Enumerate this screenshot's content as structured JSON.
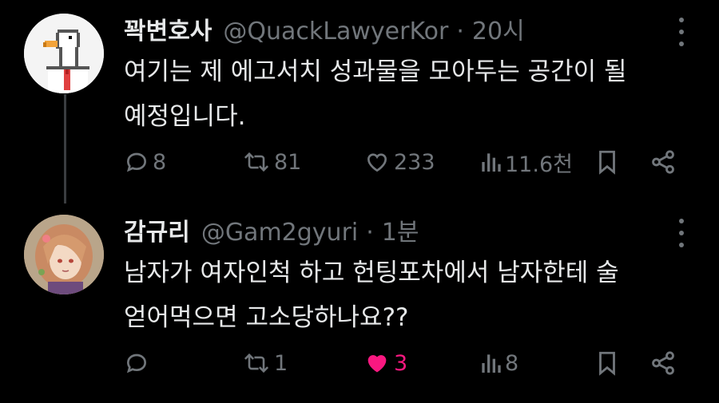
{
  "tweets": [
    {
      "display_name": "꽉변호사",
      "handle": "@QuackLawyerKor",
      "separator": "·",
      "time": "20시",
      "avatar_icon": "goose-avatar",
      "text": "여기는 제 에고서치 성과물을 모아두는 공간이 될\n예정입니다.",
      "actions": {
        "replies": "8",
        "retweets": "81",
        "likes": "233",
        "views": "11.6천",
        "liked": false
      }
    },
    {
      "display_name": "감규리",
      "handle": "@Gam2gyuri",
      "separator": "·",
      "time": "1분",
      "avatar_icon": "anime-girl-avatar",
      "text": "남자가 여자인척 하고 헌팅포차에서 남자한테 술\n얻어먹으면 고소당하나요??",
      "actions": {
        "replies": "",
        "retweets": "1",
        "likes": "3",
        "views": "8",
        "liked": true
      }
    }
  ],
  "colors": {
    "background": "#000000",
    "primary_text": "#e7e9ea",
    "secondary_text": "#71767b",
    "like_active": "#f91880",
    "thread_line": "#3a3d40"
  }
}
